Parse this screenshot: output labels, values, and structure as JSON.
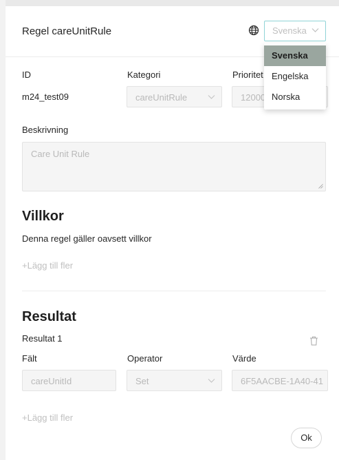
{
  "modal": {
    "title": "Regel careUnitRule",
    "language": {
      "selected": "Svenska",
      "options": [
        "Svenska",
        "Engelska",
        "Norska"
      ]
    }
  },
  "fields": {
    "id_label": "ID",
    "id_value": "m24_test09",
    "category_label": "Kategori",
    "category_value": "careUnitRule",
    "priority_label": "Prioritet",
    "priority_value": "12000",
    "description_label": "Beskrivning",
    "description_value": "Care Unit Rule"
  },
  "conditions": {
    "heading": "Villkor",
    "note": "Denna regel gäller oavsett villkor",
    "add_more": "+Lägg till fler"
  },
  "results": {
    "heading": "Resultat",
    "item_title": "Resultat 1",
    "field_label": "Fält",
    "operator_label": "Operator",
    "value_label": "Värde",
    "field_value": "careUnitId",
    "operator_value": "Set",
    "value_value": "6F5AACBE-1A40-41",
    "add_more": "+Lägg till fler"
  },
  "footer": {
    "ok_label": "Ok"
  }
}
